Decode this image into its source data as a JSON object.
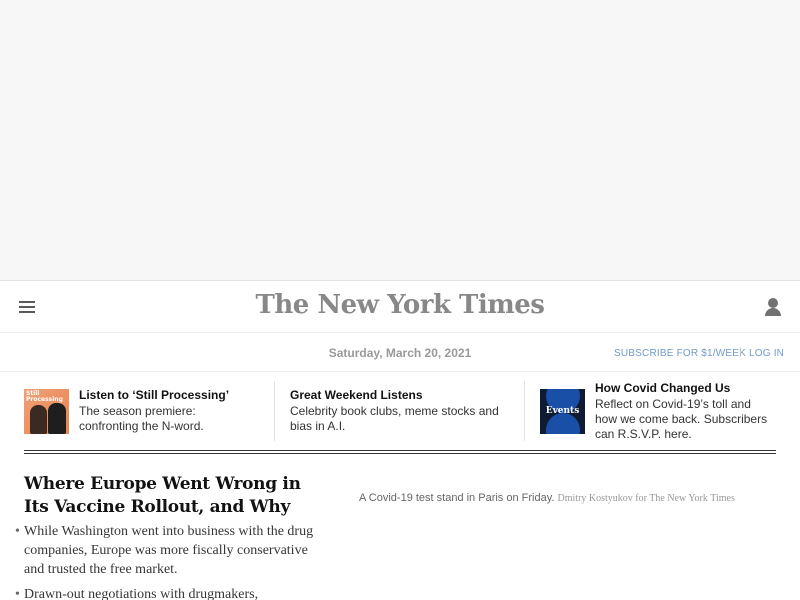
{
  "masthead": {
    "logo": "The New York Times",
    "date": "Saturday, March 20, 2021",
    "subscribe_label": "SUBSCRIBE FOR $1/WEEK",
    "separator": "|",
    "login_label": "LOG IN"
  },
  "icons": {
    "menu": "hamburger-menu-icon",
    "account": "user-account-icon"
  },
  "promos": [
    {
      "title": "Listen to ‘Still Processing’",
      "text": "The season premiere: confronting the N-word.",
      "thumb_label": "Still Processing"
    },
    {
      "title": "Great Weekend Listens",
      "text": "Celebrity book clubs, meme stocks and bias in A.I."
    },
    {
      "title": "How Covid Changed Us",
      "text": "Reflect on Covid-19’s toll and how we come back. Subscribers can R.S.V.P. here.",
      "thumb_label": "Events"
    }
  ],
  "story": {
    "headline": "Where Europe Went Wrong in Its Vaccine Rollout, and Why",
    "bullets": [
      "While Washington went into business with the drug companies, Europe was more fiscally conservative and trusted the free market.",
      "Drawn-out negotiations with drugmakers,"
    ],
    "bullet_glyph": "•",
    "caption": "A Covid-19 test stand in Paris on Friday.",
    "credit": "Dmitry Kostyukov for The New York Times"
  },
  "colors": {
    "accent_link": "#6f9cc8",
    "logo_gray": "#888888",
    "rule": "#333333"
  }
}
